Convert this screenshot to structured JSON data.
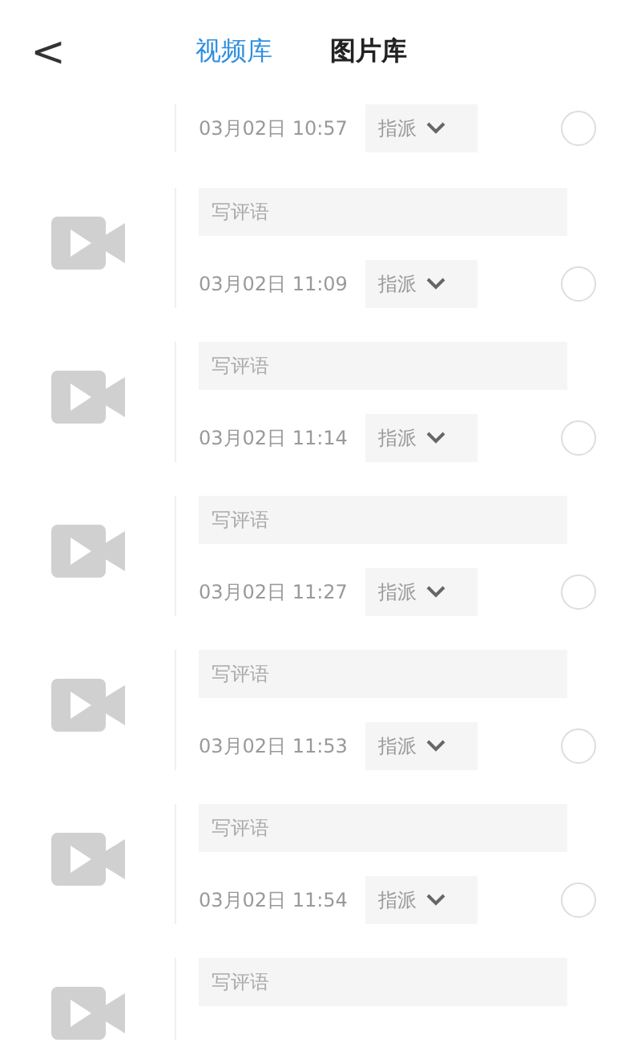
{
  "header": {
    "back": "<",
    "tabs": [
      {
        "label": "视频库",
        "selected": true
      },
      {
        "label": "图片库",
        "selected": false
      }
    ]
  },
  "items": [
    {
      "kind": "partial",
      "time": "03月02日 10:57",
      "assign": "指派",
      "selected": false
    },
    {
      "kind": "video",
      "placeholder": "写评语",
      "time": "03月02日 11:09",
      "assign": "指派",
      "selected": false
    },
    {
      "kind": "video",
      "placeholder": "写评语",
      "time": "03月02日 11:14",
      "assign": "指派",
      "selected": false
    },
    {
      "kind": "video",
      "placeholder": "写评语",
      "time": "03月02日 11:27",
      "assign": "指派",
      "selected": false
    },
    {
      "kind": "video",
      "placeholder": "写评语",
      "time": "03月02日 11:53",
      "assign": "指派",
      "selected": false
    },
    {
      "kind": "video",
      "placeholder": "写评语",
      "time": "03月02日 11:54",
      "assign": "指派",
      "selected": false
    },
    {
      "kind": "video",
      "placeholder": "写评语"
    }
  ]
}
